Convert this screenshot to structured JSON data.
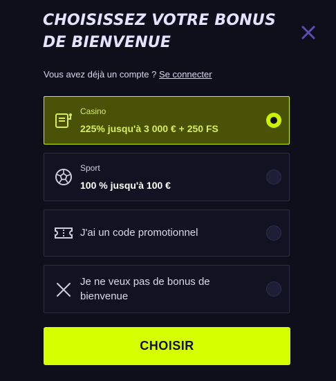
{
  "header": {
    "title": "CHOISISSEZ VOTRE BONUS DE BIENVENUE"
  },
  "login": {
    "text": "Vous avez déjà un compte ? ",
    "link": "Se connecter"
  },
  "options": [
    {
      "category": "Casino",
      "offer": "225% jusqu'à 3 000 € + 250 FS",
      "icon": "slot-machine-icon",
      "selected": true
    },
    {
      "category": "Sport",
      "offer": "100 % jusqu'à 100 €",
      "icon": "soccer-ball-icon",
      "selected": false
    },
    {
      "label": "J'ai un code promotionnel",
      "icon": "ticket-icon",
      "selected": false
    },
    {
      "label": "Je ne veux pas de bonus de bienvenue",
      "icon": "cross-icon",
      "selected": false
    }
  ],
  "cta": {
    "label": "CHOISIR"
  },
  "colors": {
    "background": "#0f0f1c",
    "accent": "#d6ff00",
    "selected_bg": "#4a5208",
    "close_icon": "#5a4fb0"
  }
}
